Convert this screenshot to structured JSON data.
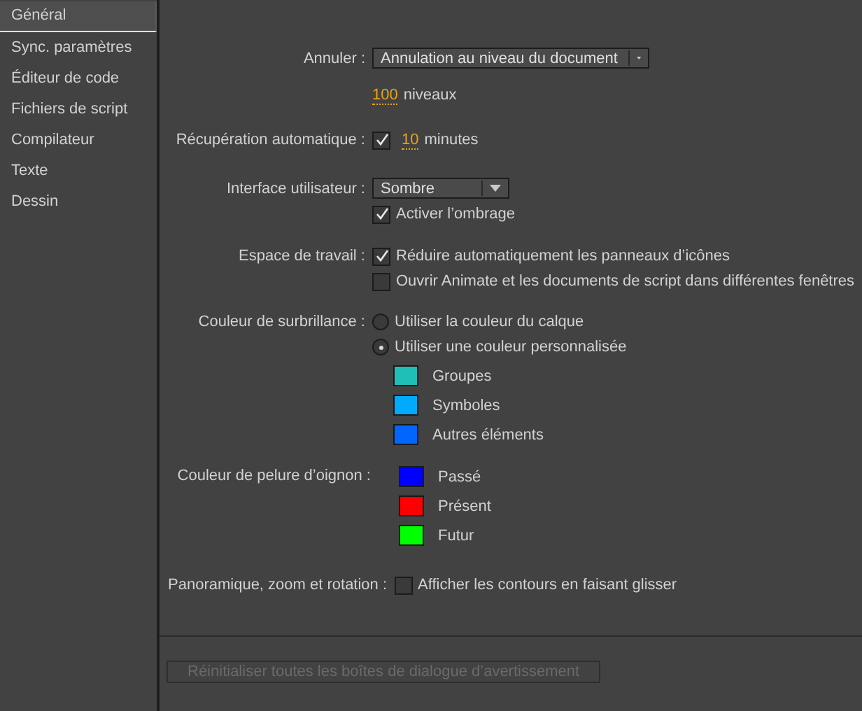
{
  "sidebar": {
    "items": [
      {
        "label": "Général",
        "selected": true
      },
      {
        "label": "Sync. paramètres",
        "selected": false
      },
      {
        "label": "Éditeur de code",
        "selected": false
      },
      {
        "label": "Fichiers de script",
        "selected": false
      },
      {
        "label": "Compilateur",
        "selected": false
      },
      {
        "label": "Texte",
        "selected": false
      },
      {
        "label": "Dessin",
        "selected": false
      }
    ]
  },
  "undo": {
    "label": "Annuler :",
    "value": "Annulation au niveau du document",
    "levels": "100",
    "levels_unit": "niveaux"
  },
  "auto_recovery": {
    "label": "Récupération automatique :",
    "checked": true,
    "value": "10",
    "unit": "minutes"
  },
  "user_interface": {
    "label": "Interface utilisateur :",
    "value": "Sombre",
    "shading": {
      "label": "Activer l’ombrage",
      "checked": true
    }
  },
  "workspace": {
    "label": "Espace de travail :",
    "options": [
      {
        "label": "Réduire automatiquement les panneaux d’icônes",
        "checked": true
      },
      {
        "label": "Ouvrir Animate et les documents de script dans différentes fenêtres",
        "checked": false
      }
    ]
  },
  "highlight_color": {
    "label": "Couleur de surbrillance :",
    "options": [
      {
        "label": "Utiliser la couleur du calque",
        "selected": false
      },
      {
        "label": "Utiliser une couleur personnalisée",
        "selected": true
      }
    ],
    "swatches": [
      {
        "label": "Groupes",
        "color": "#1fbfb8"
      },
      {
        "label": "Symboles",
        "color": "#00aaff"
      },
      {
        "label": "Autres éléments",
        "color": "#0066ff"
      }
    ]
  },
  "onion_skin": {
    "label": "Couleur de pelure d’oignon :",
    "swatches": [
      {
        "label": "Passé",
        "color": "#0000ff"
      },
      {
        "label": "Présent",
        "color": "#ff0000"
      },
      {
        "label": "Futur",
        "color": "#00ff00"
      }
    ]
  },
  "pan_zoom": {
    "label": "Panoramique, zoom et rotation :",
    "option": {
      "label": "Afficher les contours en faisant glisser",
      "checked": false
    }
  },
  "reset_button": {
    "label": "Réinitialiser toutes les boîtes de dialogue d’avertissement",
    "disabled": true
  }
}
